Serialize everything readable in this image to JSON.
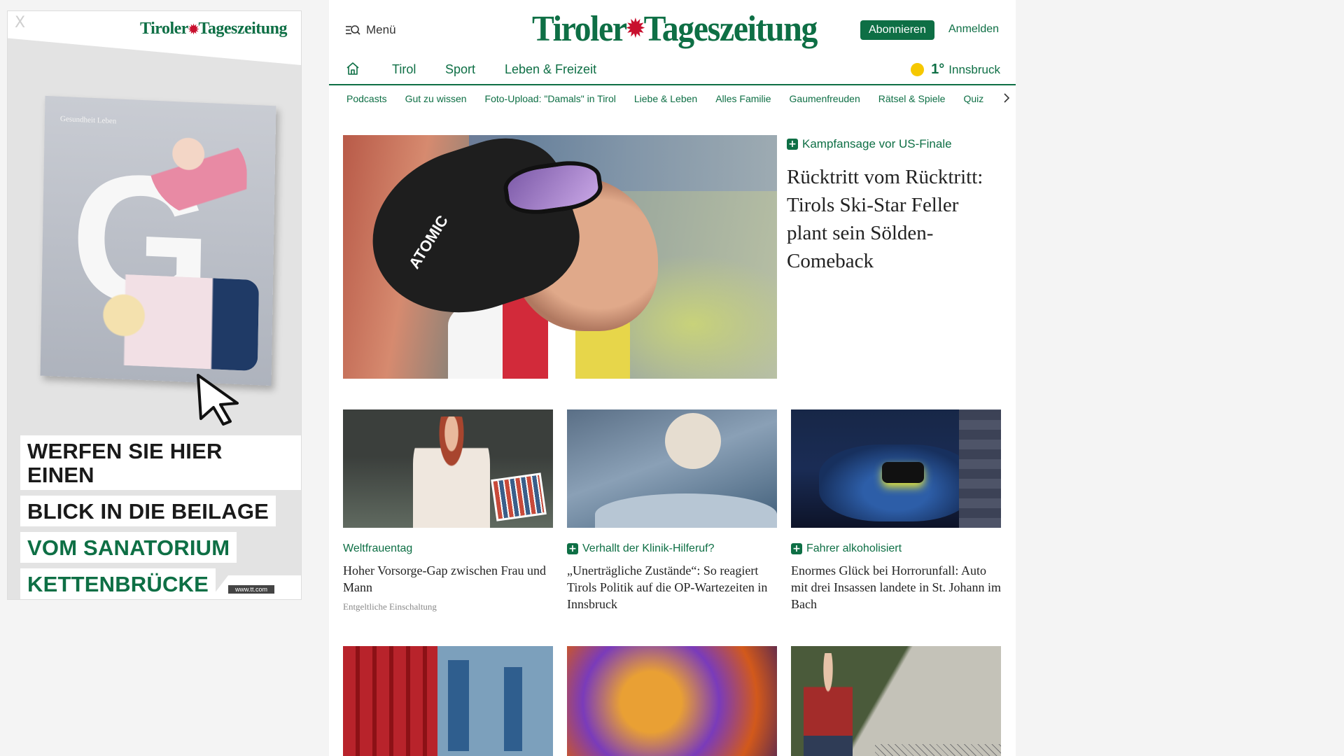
{
  "ad": {
    "close_label": "X",
    "logo_left": "Tiroler",
    "logo_right": "Tageszeitung",
    "magazine_title": "Gesundheit Leben",
    "lines": [
      {
        "text": "WERFEN SIE HIER EINEN",
        "tone": "dark"
      },
      {
        "text": "BLICK IN DIE BEILAGE",
        "tone": "dark"
      },
      {
        "text": "VOM SANATORIUM",
        "tone": "green"
      },
      {
        "text": "KETTENBRÜCKE",
        "tone": "green"
      }
    ],
    "url": "www.tt.com"
  },
  "header": {
    "menu_label": "Menü",
    "logo_left": "Tiroler",
    "logo_right": "Tageszeitung",
    "subscribe_label": "Abonnieren",
    "login_label": "Anmelden"
  },
  "nav": {
    "items": [
      "Tirol",
      "Sport",
      "Leben & Freizeit"
    ],
    "weather_temp": "1°",
    "weather_city": "Innsbruck"
  },
  "subnav": {
    "items": [
      "Podcasts",
      "Gut zu wissen",
      "Foto-Upload: \"Damals\" in Tirol",
      "Liebe & Leben",
      "Alles Familie",
      "Gaumenfreuden",
      "Rätsel & Spiele",
      "Quiz"
    ]
  },
  "hero": {
    "kicker": "Kampfansage vor US-Finale",
    "title": "Rücktritt vom Rücktritt: Tirols Ski-Star Feller plant sein Sölden-Comeback",
    "img_brand": "ATOMIC"
  },
  "cards": [
    {
      "kicker": "Weltfrauentag",
      "title": "Hoher Vorsorge-Gap zwischen Frau und Mann",
      "note": "Entgeltliche Einschaltung",
      "premium": false
    },
    {
      "kicker": "Verhallt der Klinik-Hilferuf?",
      "title": "„Unerträgliche Zustände“: So reagiert Tirols Politik auf die OP-Wartezeiten in Innsbruck",
      "premium": true
    },
    {
      "kicker": "Fahrer alkoholisiert",
      "title": "Enormes Glück bei Horrorunfall: Auto mit drei Insassen landete in St. Johann im Bach",
      "premium": true
    }
  ],
  "colors": {
    "brand": "#0e6f45",
    "accent": "#c8102e",
    "sun": "#f6c800"
  }
}
